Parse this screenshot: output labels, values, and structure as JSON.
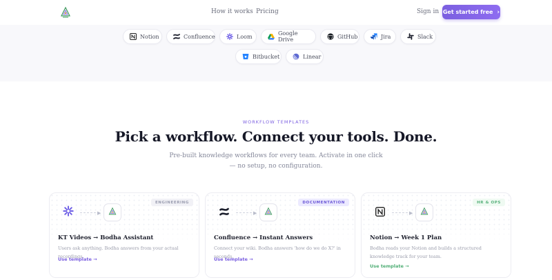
{
  "nav": {
    "links": [
      "How it works",
      "Pricing"
    ],
    "signin": "Sign in",
    "cta": "Get started free",
    "cta_icon": "chevron-right-icon"
  },
  "integrations": [
    {
      "label": "Notion",
      "icon": "notion-icon"
    },
    {
      "label": "Confluence",
      "icon": "confluence-icon"
    },
    {
      "label": "Loom",
      "icon": "loom-icon"
    },
    {
      "label": "Google Drive",
      "icon": "google-drive-icon"
    },
    {
      "label": "GitHub",
      "icon": "github-icon"
    },
    {
      "label": "Jira",
      "icon": "jira-icon"
    },
    {
      "label": "Slack",
      "icon": "slack-icon"
    },
    {
      "label": "Bitbucket",
      "icon": "bitbucket-icon"
    },
    {
      "label": "Linear",
      "icon": "linear-icon"
    }
  ],
  "section": {
    "eyebrow": "WORKFLOW TEMPLATES",
    "headline": "Pick a workflow. Connect your tools. Done.",
    "sub": "Pre-built knowledge workflows for every team. Activate in one click — no setup, no configuration."
  },
  "cards": [
    {
      "badge": "ENGINEERING",
      "title": "KT Videos → Bodha Assistant",
      "desc": "Users ask anything. Bodha answers from your actual recordings.",
      "link": "Use template →",
      "source_icon": "loom-icon"
    },
    {
      "badge": "DOCUMENTATION",
      "title": "Confluence → Instant Answers",
      "desc": "Connect your wiki. Bodha answers 'how do we do X?' in seconds.",
      "link": "Use template →",
      "source_icon": "confluence-icon"
    },
    {
      "badge": "HR & OPS",
      "title": "Notion → Week 1 Plan",
      "desc": "Bodha reads your Notion and builds a structured knowledge track for your team.",
      "link": "Use template →",
      "source_icon": "notion-icon"
    }
  ],
  "colors": {
    "accent": "#7b5fe0",
    "green": "#4fae75",
    "heading": "#161827"
  }
}
